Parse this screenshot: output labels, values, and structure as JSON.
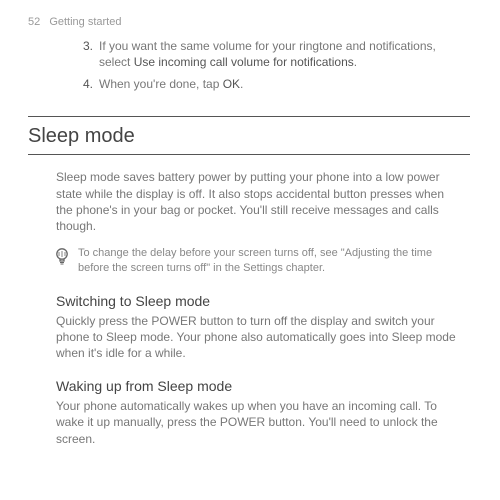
{
  "header": {
    "page_number": "52",
    "chapter": "Getting started"
  },
  "list": {
    "item3": {
      "num": "3.",
      "text_before": "If you want the same volume for your ringtone and notifications, select ",
      "bold": "Use incoming call volume for notifications",
      "after": "."
    },
    "item4": {
      "num": "4.",
      "text_before": "When you're done, tap ",
      "bold": "OK",
      "after": "."
    }
  },
  "section": {
    "title": "Sleep mode",
    "intro": "Sleep mode saves battery power by putting your phone into a low power state while the display is off. It also stops accidental button presses when the phone's in your bag or pocket. You'll still receive messages and calls though."
  },
  "tip": {
    "text": "To change the delay before your screen turns off, see \"Adjusting the time before the screen turns off\" in the Settings chapter."
  },
  "sub1": {
    "heading": "Switching to Sleep mode",
    "text": "Quickly press the POWER button to turn off the display and switch your phone to Sleep mode. Your phone also automatically goes into Sleep mode when it's idle for a while."
  },
  "sub2": {
    "heading": "Waking up from Sleep mode",
    "text": "Your phone automatically wakes up when you have an incoming call. To wake it up manually, press the POWER button. You'll need to unlock the screen."
  }
}
